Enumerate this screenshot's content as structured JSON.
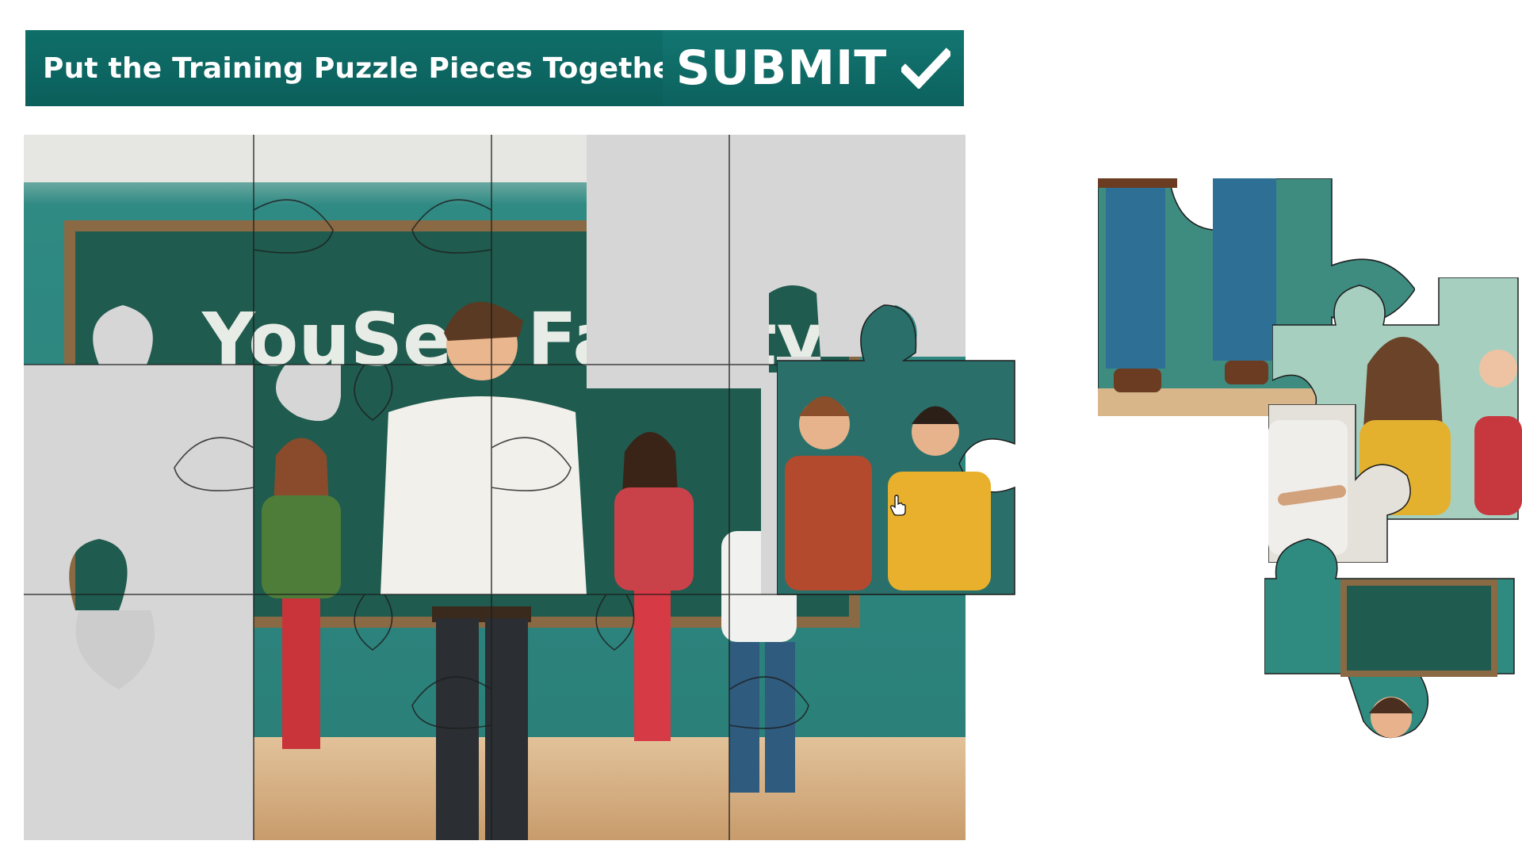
{
  "header": {
    "title": "Put the Training Puzzle Pieces Together!",
    "submit_label": "SUBMIT",
    "submit_icon": "checkmark-icon",
    "background_color": "#0f6e69"
  },
  "board": {
    "chalkboard_text": "YouSee Faculty",
    "empty_slot_color": "#d6d6d6",
    "wall_color": "#2f8a83",
    "chalkboard_color": "#1f5b4e",
    "floor_color": "#d8b48a"
  },
  "cursor": {
    "icon": "hand-pointer-icon"
  }
}
